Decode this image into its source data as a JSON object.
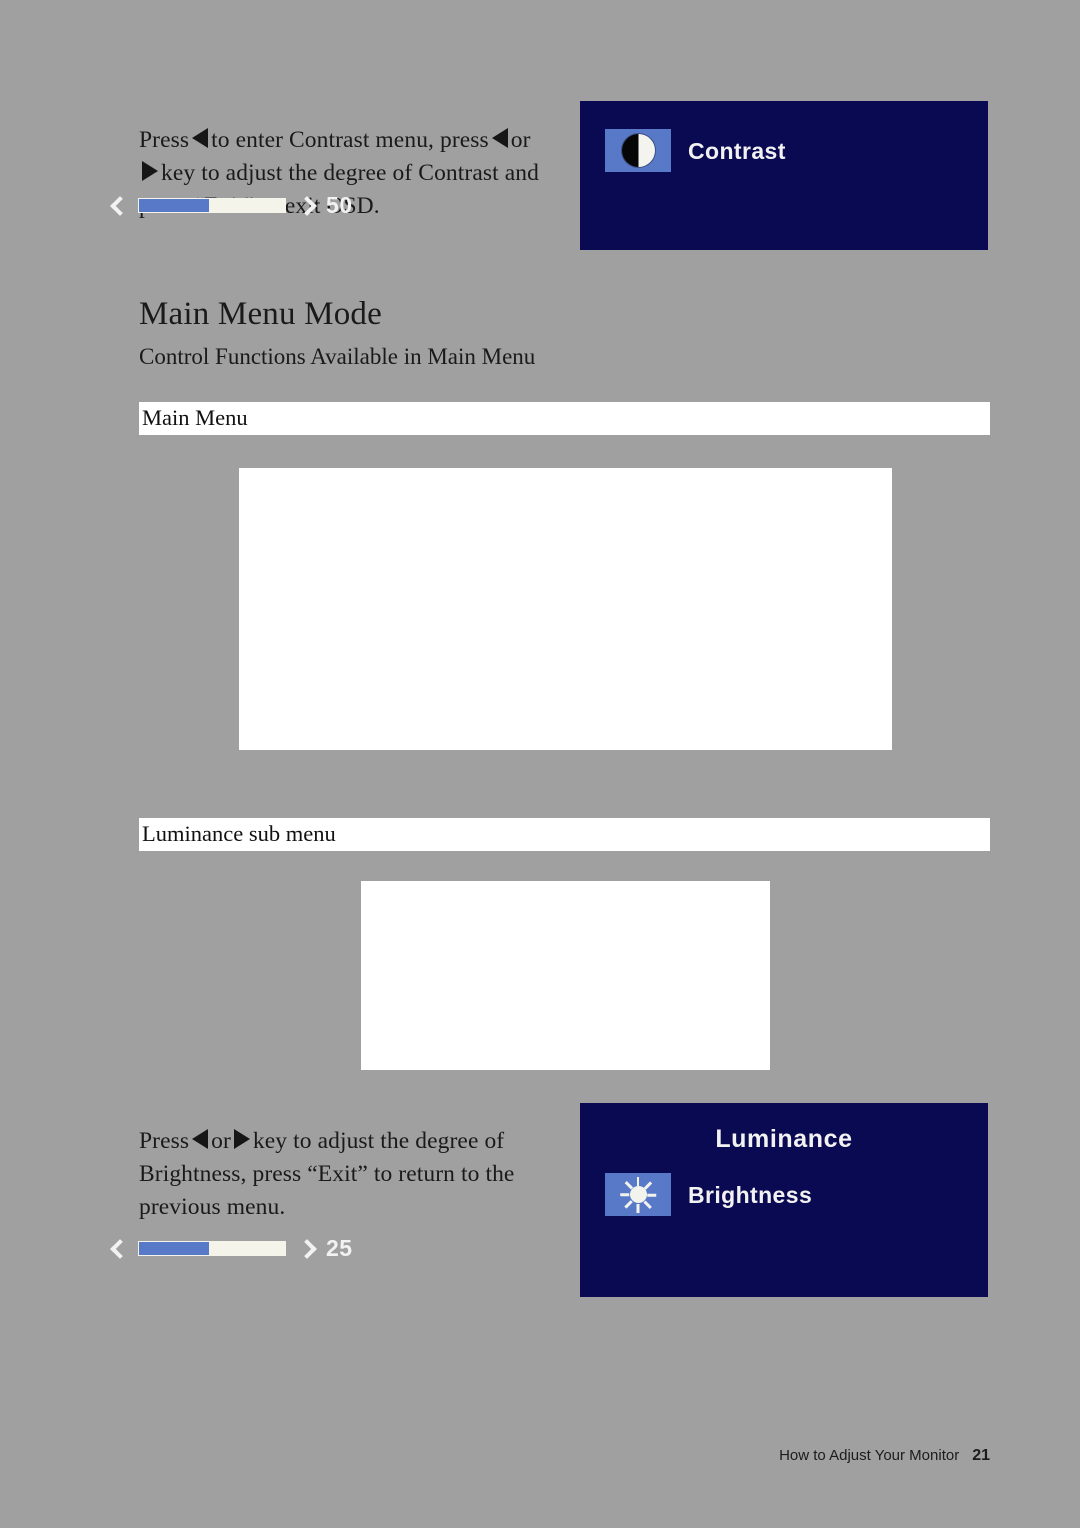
{
  "page": {
    "background_color": "#a0a0a0",
    "heading": "Main Menu Mode",
    "subheading": "Control Functions Available in Main Menu"
  },
  "contrast_instructions": {
    "line1_a": "Press",
    "line1_b": "to enter Contrast menu, press",
    "line1_c": "or",
    "line2": "key to adjust the degree of Contrast and",
    "line3": "press “Exit” to exit OSD."
  },
  "brightness_instructions": {
    "line1_a": "Press",
    "line1_b": "or",
    "line1_c": "key to adjust the degree of",
    "line2": "Brightness, press “Exit” to return to the",
    "line3": "previous menu."
  },
  "bands": {
    "main_menu": "Main Menu",
    "luminance_sub_menu": "Luminance sub menu"
  },
  "osd_contrast": {
    "icon_name": "contrast-icon",
    "label": "Contrast",
    "value": "50",
    "fill_percent": 48,
    "left_chevron": "‹",
    "right_chevron": "›",
    "panel_color": "#0a0a52",
    "accent_color": "#5878c8",
    "track_color": "#f4f4ea"
  },
  "osd_luminance": {
    "title": "Luminance",
    "icon_name": "brightness-sun-icon",
    "label": "Brightness",
    "value": "25",
    "fill_percent": 48,
    "left_chevron": "‹",
    "right_chevron": "›",
    "panel_color": "#0a0a52",
    "accent_color": "#5878c8",
    "track_color": "#f4f4ea"
  },
  "footer": {
    "chapter": "How to Adjust Your Monitor",
    "page_number": "21"
  }
}
